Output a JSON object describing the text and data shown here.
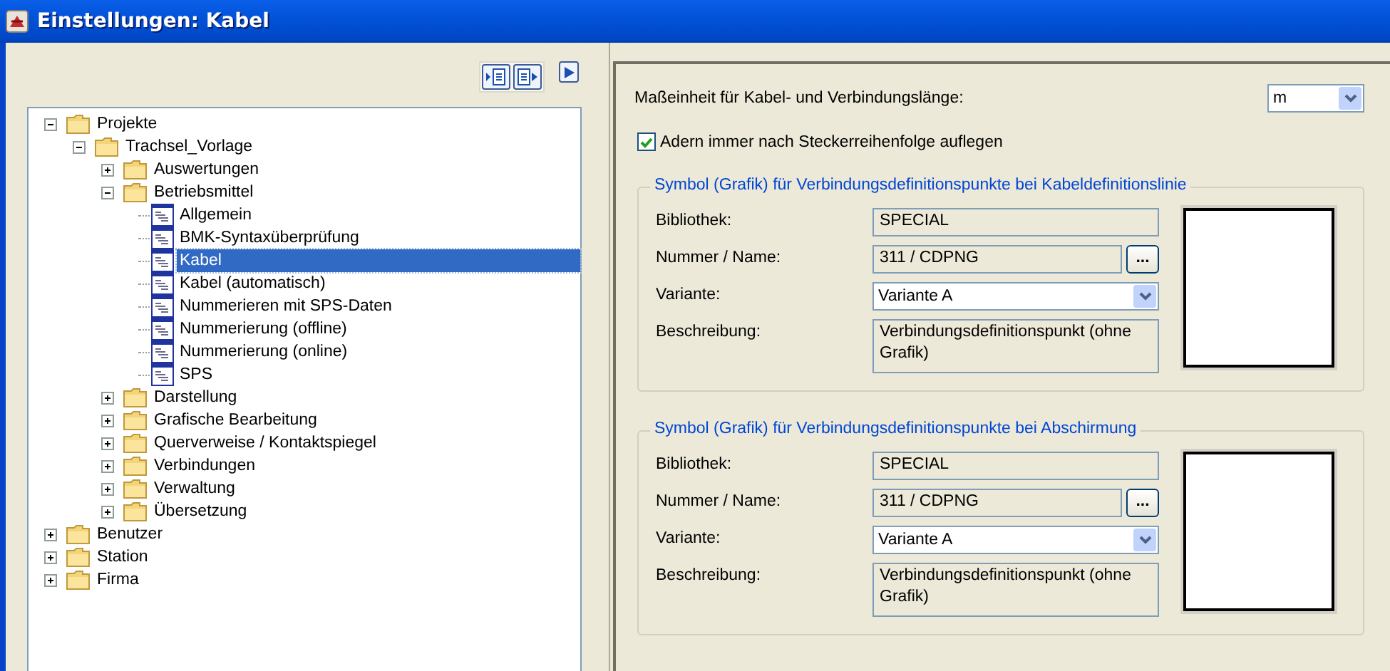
{
  "window": {
    "title": "Einstellungen: Kabel"
  },
  "tree": [
    {
      "label": "Projekte",
      "kind": "folder",
      "expanded": true,
      "selected": false,
      "children": [
        {
          "label": "Trachsel_Vorlage",
          "kind": "folder",
          "expanded": true,
          "selected": false,
          "children": [
            {
              "label": "Auswertungen",
              "kind": "folder",
              "expanded": false,
              "selected": false
            },
            {
              "label": "Betriebsmittel",
              "kind": "folder",
              "expanded": true,
              "selected": false,
              "children": [
                {
                  "label": "Allgemein",
                  "kind": "page",
                  "selected": false
                },
                {
                  "label": "BMK-Syntaxüberprüfung",
                  "kind": "page",
                  "selected": false
                },
                {
                  "label": "Kabel",
                  "kind": "page",
                  "selected": true
                },
                {
                  "label": "Kabel (automatisch)",
                  "kind": "page",
                  "selected": false
                },
                {
                  "label": "Nummerieren mit SPS-Daten",
                  "kind": "page",
                  "selected": false
                },
                {
                  "label": "Nummerierung (offline)",
                  "kind": "page",
                  "selected": false
                },
                {
                  "label": "Nummerierung (online)",
                  "kind": "page",
                  "selected": false
                },
                {
                  "label": "SPS",
                  "kind": "page",
                  "selected": false
                }
              ]
            },
            {
              "label": "Darstellung",
              "kind": "folder",
              "expanded": false,
              "selected": false
            },
            {
              "label": "Grafische Bearbeitung",
              "kind": "folder",
              "expanded": false,
              "selected": false
            },
            {
              "label": "Querverweise / Kontaktspiegel",
              "kind": "folder",
              "expanded": false,
              "selected": false
            },
            {
              "label": "Verbindungen",
              "kind": "folder",
              "expanded": false,
              "selected": false
            },
            {
              "label": "Verwaltung",
              "kind": "folder",
              "expanded": false,
              "selected": false
            },
            {
              "label": "Übersetzung",
              "kind": "folder",
              "expanded": false,
              "selected": false
            }
          ]
        }
      ]
    },
    {
      "label": "Benutzer",
      "kind": "folder",
      "expanded": false,
      "selected": false
    },
    {
      "label": "Station",
      "kind": "folder",
      "expanded": false,
      "selected": false
    },
    {
      "label": "Firma",
      "kind": "folder",
      "expanded": false,
      "selected": false
    }
  ],
  "settings": {
    "unit": {
      "label": "Maßeinheit für Kabel- und Verbindungslänge:",
      "value": "m"
    },
    "checkbox": {
      "label": "Adern immer nach Steckerreihenfolge auflegen",
      "checked": true
    },
    "groups": [
      {
        "title": "Symbol (Grafik) für Verbindungsdefinitionspunkte bei Kabeldefinitionslinie",
        "fields": [
          {
            "kind": "readonly",
            "label": "Bibliothek:",
            "value": "SPECIAL"
          },
          {
            "kind": "browse",
            "label": "Nummer / Name:",
            "value": "311 / CDPNG",
            "button": "..."
          },
          {
            "kind": "dropdown",
            "label": "Variante:",
            "value": "Variante A"
          },
          {
            "kind": "multiline",
            "label": "Beschreibung:",
            "value": "Verbindungsdefinitionspunkt (ohne Grafik)"
          }
        ]
      },
      {
        "title": "Symbol (Grafik) für Verbindungsdefinitionspunkte bei Abschirmung",
        "fields": [
          {
            "kind": "readonly",
            "label": "Bibliothek:",
            "value": "SPECIAL"
          },
          {
            "kind": "browse",
            "label": "Nummer / Name:",
            "value": "311 / CDPNG",
            "button": "..."
          },
          {
            "kind": "dropdown",
            "label": "Variante:",
            "value": "Variante A"
          },
          {
            "kind": "multiline",
            "label": "Beschreibung:",
            "value": "Verbindungsdefinitionspunkt (ohne Grafik)"
          }
        ]
      }
    ]
  }
}
